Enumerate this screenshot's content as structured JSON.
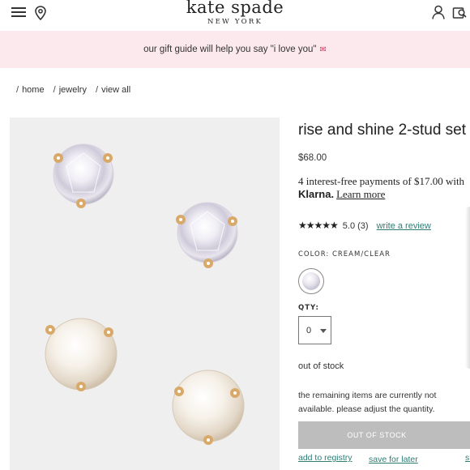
{
  "header": {
    "brand_name": "kate spade",
    "brand_sub": "NEW YORK",
    "icons": [
      "hamburger-menu-icon",
      "location-pin-icon",
      "user-account-icon",
      "shopping-bag-icon"
    ]
  },
  "promo": {
    "text": "our gift guide will help you say \"i love you\"",
    "heart_icon": "love-letter-icon"
  },
  "breadcrumb": {
    "items": [
      "home",
      "jewelry",
      "view all"
    ]
  },
  "product": {
    "title": "rise and shine 2-stud set",
    "price": "$68.00",
    "klarna_text": "4 interest-free payments of $17.00 with",
    "klarna_brand": "Klarna.",
    "klarna_link": "Learn more",
    "rating_value": "5.0 (3)",
    "review_link": "write a review",
    "stars": 5,
    "color_label": "COLOR: CREAM/CLEAR",
    "qty_label": "QTY:",
    "qty_value": "0",
    "stock_status": "out of stock",
    "remaining_text": "the remaining items are currently not available. please adjust the quantity.",
    "button_label": "OUT OF STOCK",
    "registry_link": "add to registry",
    "save_later_link": "save for later",
    "share_partial": "sh"
  },
  "colors": {
    "promo_bg": "#fbe9ee",
    "link_teal": "#2f7c74",
    "button_disabled": "#bdbdbd",
    "gold": "#d9a96a"
  }
}
